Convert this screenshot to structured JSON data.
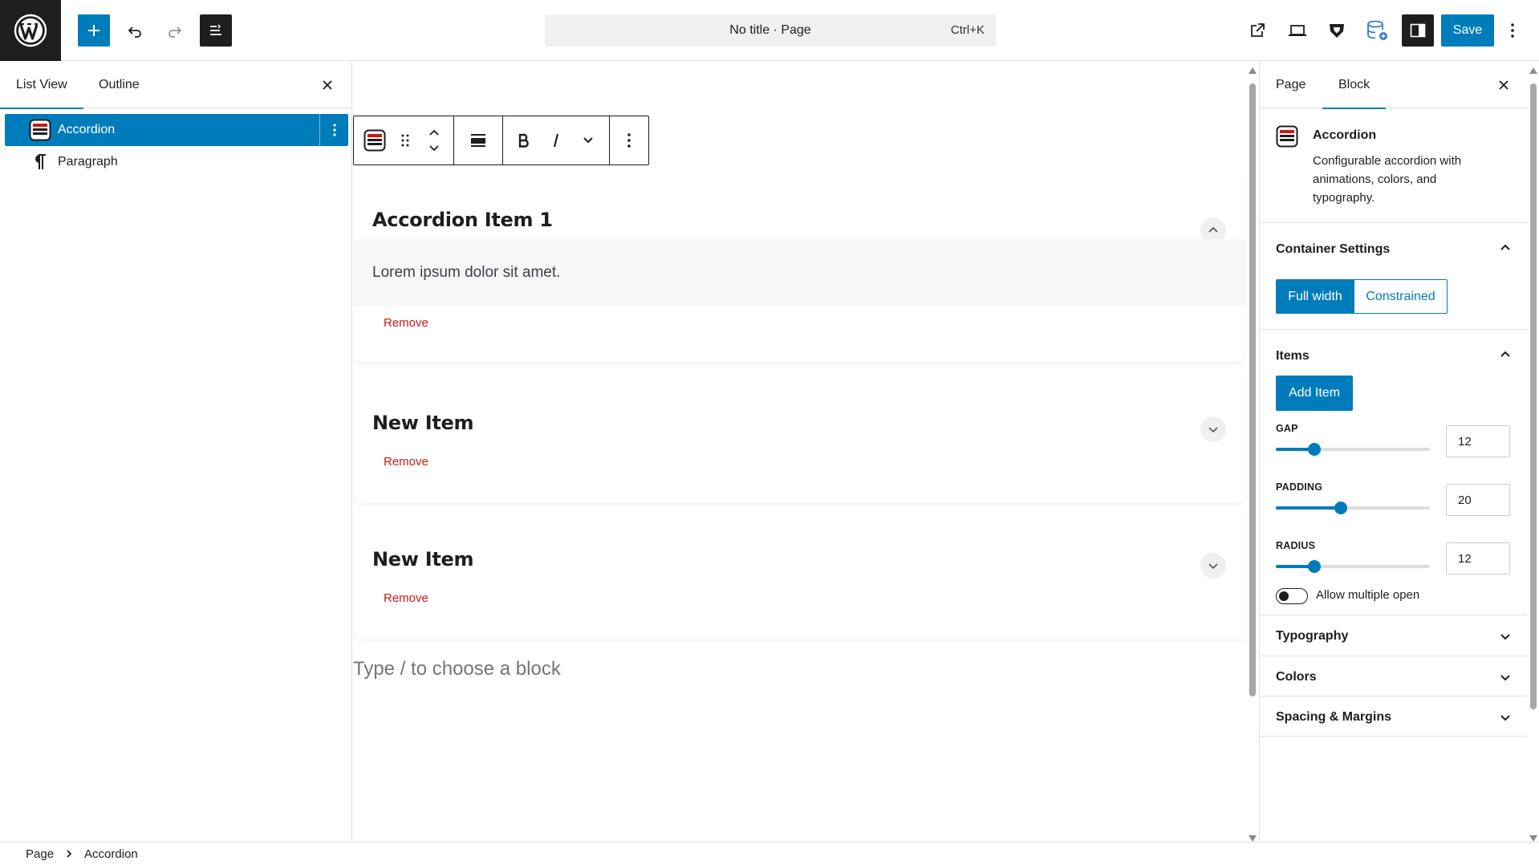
{
  "app": {
    "document_title": "No title · Page",
    "command_shortcut": "Ctrl+K",
    "save_label": "Save"
  },
  "icons": {
    "logo": "wordpress-logo-icon",
    "add": "plus-icon",
    "undo": "undo-icon",
    "redo": "redo-icon",
    "document_overview": "list-view-icon",
    "view_page": "external-link-icon",
    "preview": "desktop-preview-icon",
    "shield": "shield-icon",
    "database": "database-icon",
    "settings": "sidebar-settings-icon",
    "options": "more-vertical-icon"
  },
  "colors": {
    "accent": "#007cba",
    "dark": "#1e1e1e",
    "danger": "#cc1818",
    "accordion_icon": "#cc1818"
  },
  "left_panel": {
    "tabs": [
      {
        "label": "List View",
        "active": true
      },
      {
        "label": "Outline",
        "active": false
      }
    ],
    "tree": [
      {
        "label": "Accordion",
        "selected": true
      },
      {
        "label": "Paragraph",
        "selected": false
      }
    ]
  },
  "canvas": {
    "items": [
      {
        "title": "Accordion Item 1",
        "open": true,
        "content": "Lorem ipsum dolor sit amet.",
        "remove_label": "Remove"
      },
      {
        "title": "New Item",
        "open": false,
        "content": "",
        "remove_label": "Remove"
      },
      {
        "title": "New Item",
        "open": false,
        "content": "",
        "remove_label": "Remove"
      }
    ],
    "placeholder": "Type / to choose a block"
  },
  "right_panel": {
    "tabs": [
      {
        "label": "Page",
        "active": false
      },
      {
        "label": "Block",
        "active": true
      }
    ],
    "block": {
      "name": "Accordion",
      "description": "Configurable accordion with animations, colors, and typography."
    },
    "container_settings": {
      "title": "Container Settings",
      "options": [
        "Full width",
        "Constrained"
      ],
      "selected": "Full width"
    },
    "items_section": {
      "title": "Items",
      "add_label": "Add Item",
      "gap": {
        "label": "GAP",
        "value": "12",
        "fraction": 0.25
      },
      "padding": {
        "label": "PADDING",
        "value": "20",
        "fraction": 0.42
      },
      "radius": {
        "label": "RADIUS",
        "value": "12",
        "fraction": 0.25
      },
      "allow_multiple": {
        "label": "Allow multiple open",
        "on": false
      }
    },
    "collapsed_sections": [
      "Typography",
      "Colors",
      "Spacing & Margins"
    ]
  },
  "breadcrumbs": [
    "Page",
    "Accordion"
  ]
}
